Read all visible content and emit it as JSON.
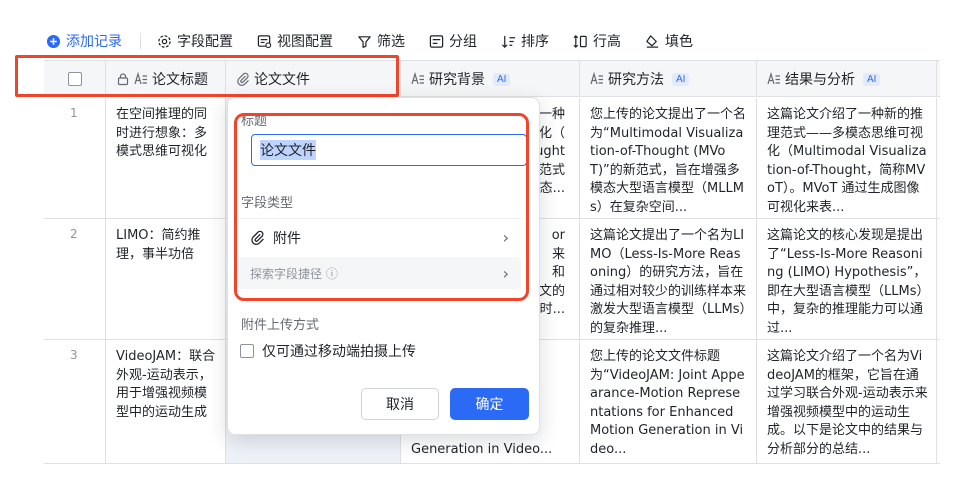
{
  "toolbar": {
    "add": "添加记录",
    "field_config": "字段配置",
    "view_config": "视图配置",
    "filter": "筛选",
    "group": "分组",
    "sort": "排序",
    "row_height": "行高",
    "fill": "填色"
  },
  "columns": {
    "title": "论文标题",
    "file": "论文文件",
    "background": "研究背景",
    "method": "研究方法",
    "result": "结果与分析",
    "ai_badge": "AI"
  },
  "rows": [
    {
      "num": "1",
      "title": "在空间推理的同时进行想象：多模式思维可视化",
      "bg_frag": [
        "一种",
        "化（",
        "ught",
        "范式",
        "态..."
      ],
      "method": "您上传的论文提出了一个名为“Multimodal Visualization-of-Thought (MVoT)”的新范式，旨在增强多模态大型语言模型（MLLMs）在复杂空间...",
      "result": "这篇论文介绍了一种新的推理范式——多模态思维可视化（Multimodal Visualization-of-Thought，简称MVoT）。MVoT 通过生成图像可视化来表..."
    },
    {
      "num": "2",
      "title": "LIMO：简约推理，事半功倍",
      "bg_frag": [
        "or",
        "来",
        "和",
        "文的",
        "时..."
      ],
      "method": "这篇论文提出了一个名为LIMO（Less-Is-More Reasoning）的研究方法，旨在通过相对较少的训练样本来激发大型语言模型（LLMs）的复杂推理...",
      "result": "这篇论文的核心发现是提出了“Less-Is-More Reasoning (LIMO) Hypothesis”，即在大型语言模型（LLMs）中，复杂的推理能力可以通过..."
    },
    {
      "num": "3",
      "title": "VideoJAM：联合外观-运动表示，用于增强视频模型中的运动生成",
      "bg_tail": "Generation in Video...",
      "method": "您上传的论文文件标题为“VideoJAM: Joint Appearance-Motion Representations for Enhanced Motion Generation in Video...",
      "result": "这篇论文介绍了一个名为VideoJAM的框架，它旨在通过学习联合外观-运动表示来增强视频模型中的运动生成。以下是论文中的结果与分析部分的总结..."
    }
  ],
  "popup": {
    "title_label": "标题",
    "title_value": "论文文件",
    "field_type_label": "字段类型",
    "field_type_value": "附件",
    "shortcut": "探索字段捷径 ⓘ",
    "upload_label": "附件上传方式",
    "mobile_only": "仅可通过移动端拍摄上传",
    "cancel": "取消",
    "ok": "确定"
  },
  "colors": {
    "accent": "#2b6af5",
    "highlight": "#f0452a"
  }
}
